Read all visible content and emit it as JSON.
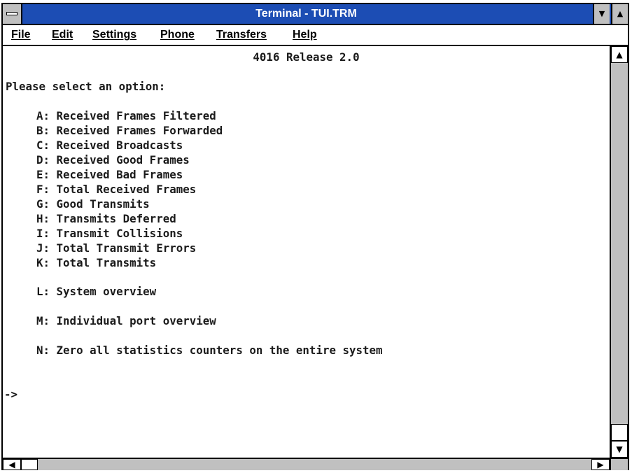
{
  "window": {
    "title": "Terminal - TUI.TRM",
    "title_bar_color": "#1c4db4"
  },
  "title_buttons": {
    "system_menu_icon": "system-menu-bar-icon",
    "minimize_glyph": "▼",
    "maximize_glyph": "▲"
  },
  "menubar": {
    "items": [
      {
        "label": "File"
      },
      {
        "label": "Edit"
      },
      {
        "label": "Settings"
      },
      {
        "label": "Phone"
      },
      {
        "label": "Transfers"
      },
      {
        "label": "Help"
      }
    ]
  },
  "terminal": {
    "header": "4016 Release 2.0",
    "prompt_heading": "Please select an option:",
    "options": [
      "A: Received Frames Filtered",
      "B: Received Frames Forwarded",
      "C: Received Broadcasts",
      "D: Received Good Frames",
      "E: Received Bad Frames",
      "F: Total Received Frames",
      "G: Good Transmits",
      "H: Transmits Deferred",
      "I: Transmit Collisions",
      "J: Total Transmit Errors",
      "K: Total Transmits"
    ],
    "option_l": "L: System overview",
    "option_m": "M: Individual port overview",
    "option_n": "N: Zero all statistics counters on the entire system",
    "cursor_prompt": "->"
  },
  "scrollbars": {
    "up_glyph": "▲",
    "down_glyph": "▼",
    "left_glyph": "◀",
    "right_glyph": "▶"
  }
}
